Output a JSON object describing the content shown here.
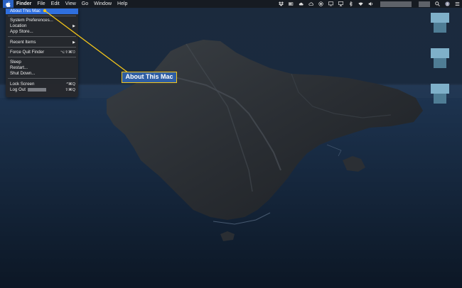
{
  "menubar": {
    "apple_icon": "apple-logo-icon",
    "app_name": "Finder",
    "menus": [
      "File",
      "Edit",
      "View",
      "Go",
      "Window",
      "Help"
    ],
    "status_icons": [
      "dropbox-icon",
      "battery-icon",
      "cloud-icon",
      "creative-cloud-icon",
      "record-icon",
      "display-icon",
      "airplay-icon",
      "bluetooth-icon",
      "wifi-icon",
      "volume-icon",
      "search-icon",
      "user-icon"
    ]
  },
  "apple_menu": {
    "about": "About This Mac",
    "system_preferences": "System Preferences...",
    "location": "Location",
    "app_store": "App Store...",
    "recent_items": "Recent Items",
    "force_quit": "Force Quit Finder",
    "force_quit_shortcut": "⌥⇧⌘⎋",
    "sleep": "Sleep",
    "restart": "Restart...",
    "shut_down": "Shut Down...",
    "lock_screen": "Lock Screen",
    "lock_screen_shortcut": "^⌘Q",
    "log_out": "Log Out",
    "log_out_shortcut": "⇧⌘Q"
  },
  "callout": {
    "label": "About This Mac",
    "border_color": "#f3c51a",
    "fill_color": "#2f5ea3"
  },
  "accent_color": "#2f6fde"
}
